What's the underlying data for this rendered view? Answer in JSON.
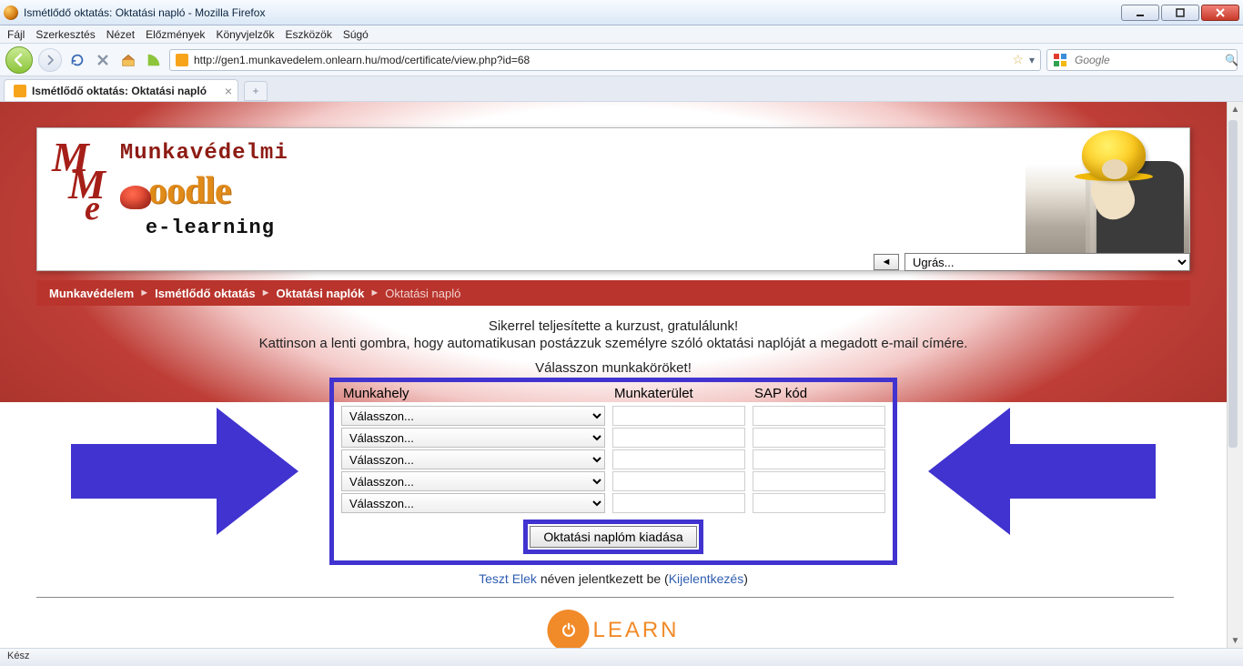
{
  "window": {
    "title": "Ismétlődő oktatás: Oktatási napló - Mozilla Firefox"
  },
  "menus": {
    "file": "Fájl",
    "edit": "Szerkesztés",
    "view": "Nézet",
    "history": "Előzmények",
    "bookmarks": "Könyvjelzők",
    "tools": "Eszközök",
    "help": "Súgó"
  },
  "url": "http://gen1.munkavedelem.onlearn.hu/mod/certificate/view.php?id=68",
  "search_placeholder": "Google",
  "tab_title": "Ismétlődő oktatás: Oktatási napló",
  "header": {
    "line1": "Munkavédelmi",
    "moodle": "oodle",
    "line3": "e-learning",
    "ugras": "Ugrás..."
  },
  "breadcrumbs": {
    "a": "Munkavédelem",
    "b": "Ismétlődő oktatás",
    "c": "Oktatási naplók",
    "d": "Oktatási napló"
  },
  "copy": {
    "r1": "Sikerrel teljesítette a kurzust, gratulálunk!",
    "r2": "Kattinson a lenti gombra, hogy automatikusan postázzuk személyre szóló oktatási naplóját a megadott e-mail címére.",
    "r3": "Válasszon munkaköröket!"
  },
  "form": {
    "h1": "Munkahely",
    "h2": "Munkaterület",
    "h3": "SAP kód",
    "opt": "Válasszon...",
    "button": "Oktatási naplóm kiadása"
  },
  "login": {
    "user": "Teszt Elek",
    "mid": " néven jelentkezett be (",
    "logout": "Kijelentkezés",
    "end": ")"
  },
  "onlearn": {
    "circle": "ON",
    "text": "LEARN"
  },
  "status": "Kész"
}
